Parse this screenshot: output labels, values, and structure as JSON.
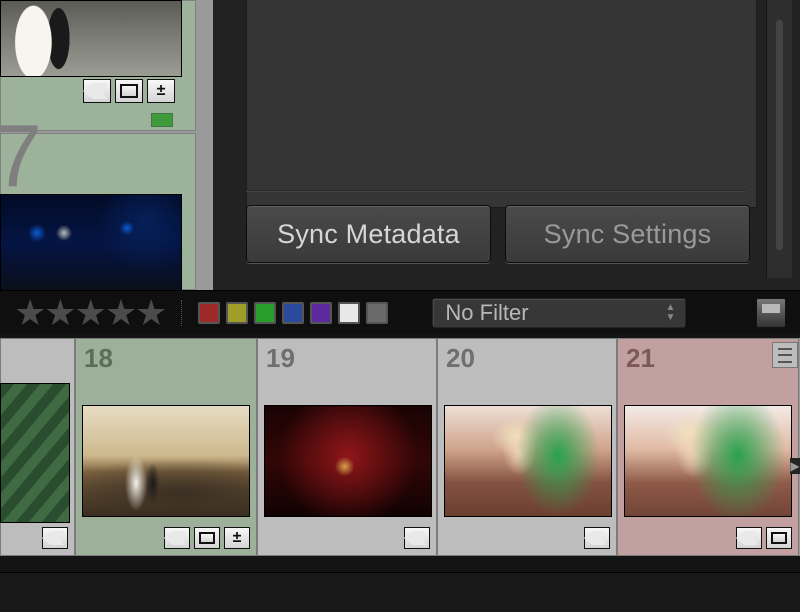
{
  "left_grid": {
    "cell_top": {
      "badges": [
        "keywords",
        "collection",
        "develop-adjust"
      ],
      "color_label": "#3d9a3d"
    },
    "cell_bottom": {
      "index_partial": "7"
    }
  },
  "panel": {
    "sync_metadata_label": "Sync Metadata",
    "sync_settings_label": "Sync Settings"
  },
  "toolbar": {
    "rating_stars": 5,
    "color_filters": [
      {
        "name": "red",
        "color": "#9e2a28"
      },
      {
        "name": "yellow",
        "color": "#9e9e28"
      },
      {
        "name": "green",
        "color": "#2a9e2a"
      },
      {
        "name": "blue",
        "color": "#2a4a9e"
      },
      {
        "name": "purple",
        "color": "#5a2a9e"
      },
      {
        "name": "white",
        "color": "#e8e8e8"
      },
      {
        "name": "gray",
        "color": "#6a6a6a"
      }
    ],
    "filter_label": "No Filter"
  },
  "filmstrip": [
    {
      "index": "",
      "selected": false,
      "badge_count": 1
    },
    {
      "index": "18",
      "selected": true,
      "badge_count": 3
    },
    {
      "index": "19",
      "selected": false,
      "badge_count": 1
    },
    {
      "index": "20",
      "selected": false,
      "badge_count": 1
    },
    {
      "index": "21",
      "selected": false,
      "badge_count": 2,
      "red": true
    }
  ]
}
